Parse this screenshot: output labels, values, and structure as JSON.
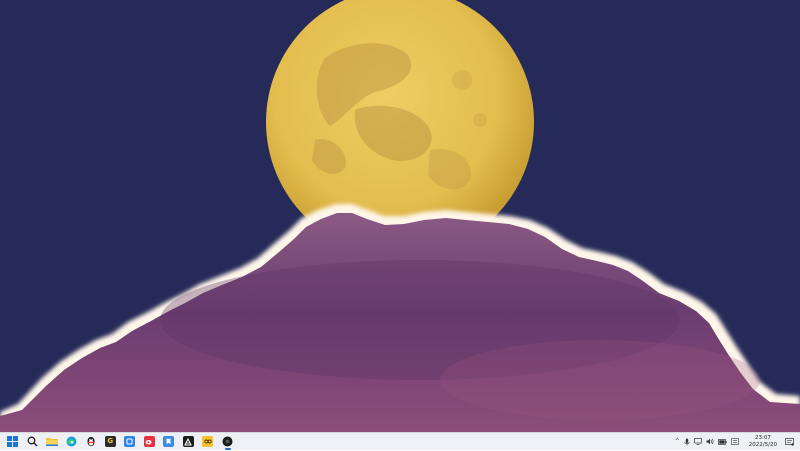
{
  "wallpaper": {
    "sky_color": "#252a58",
    "moon_color": "#e3bd4e",
    "cloud_color": "#6b3d70",
    "cloud_rim_color": "#fff6ea"
  },
  "taskbar": {
    "background": "#eef0f5",
    "pinned": [
      {
        "name": "start-button",
        "icon": "windows-logo-icon",
        "active": false
      },
      {
        "name": "search-button",
        "icon": "search-icon",
        "active": false
      },
      {
        "name": "file-explorer-button",
        "icon": "folder-icon",
        "active": false
      },
      {
        "name": "edge-button",
        "icon": "edge-browser-icon",
        "active": false
      },
      {
        "name": "qq-button",
        "icon": "qq-penguin-icon",
        "active": false
      },
      {
        "name": "app-g-button",
        "icon": "g-app-icon",
        "active": false
      },
      {
        "name": "app-blue-square-button",
        "icon": "blue-app-icon",
        "active": false
      },
      {
        "name": "weibo-button",
        "icon": "weibo-icon",
        "active": false
      },
      {
        "name": "app-blue-bookmark-button",
        "icon": "bookmark-app-icon",
        "active": false
      },
      {
        "name": "app-black-button",
        "icon": "black-app-icon",
        "active": false
      },
      {
        "name": "app-yellow-button",
        "icon": "yellow-app-icon",
        "active": false
      },
      {
        "name": "app-dark-circle-button",
        "icon": "dark-circle-app-icon",
        "active": true
      }
    ],
    "tray": {
      "chevron_glyph": "^",
      "mic_glyph": "🎤",
      "network_glyph": "▭",
      "volume_glyph": "◁)",
      "battery_glyph": "▬",
      "ime_glyph": "拼",
      "time": "23:07",
      "date": "2022/5/20",
      "notification_glyph": "▤"
    }
  }
}
